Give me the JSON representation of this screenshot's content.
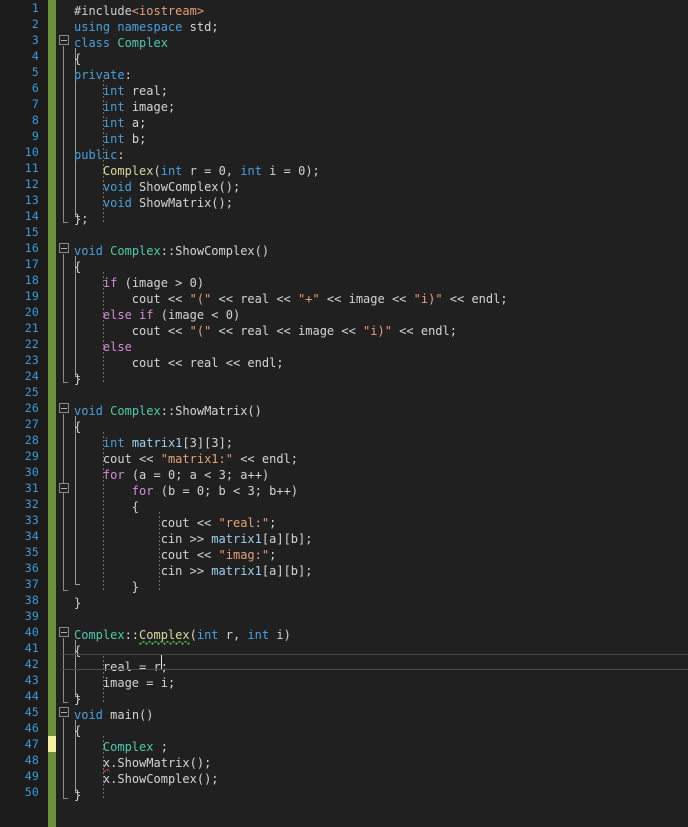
{
  "editor": {
    "language": "C++",
    "theme": "dark",
    "colors": {
      "background": "#202020",
      "gutter_background": "#1b1b1b",
      "line_number": "#3f9ad6",
      "keyword": "#4a9fdc",
      "control_keyword": "#d38fd3",
      "class_type": "#4ec9a6",
      "function_decl": "#d8d8a0",
      "string": "#e5a07a",
      "identifier": "#d4d4d4",
      "variable": "#9fd0ee",
      "change_bar_saved": "#6a8f3d",
      "change_bar_unsaved": "#f0f0a0",
      "error_squiggle": "#d64b3c",
      "warning_squiggle": "#4fbf4f",
      "current_line_border": "#4a4a4a",
      "caret": "#e8e8e8"
    },
    "first_line": 1,
    "last_line": 50,
    "current_line": 42,
    "caret_column": 14,
    "line_numbers": [
      1,
      2,
      3,
      4,
      5,
      6,
      7,
      8,
      9,
      10,
      11,
      12,
      13,
      14,
      15,
      16,
      17,
      18,
      19,
      20,
      21,
      22,
      23,
      24,
      25,
      26,
      27,
      28,
      29,
      30,
      31,
      32,
      33,
      34,
      35,
      36,
      37,
      38,
      39,
      40,
      41,
      42,
      43,
      44,
      45,
      46,
      47,
      48,
      49,
      50
    ],
    "fold_markers": [
      3,
      16,
      26,
      31,
      40,
      45
    ],
    "unsaved_change_lines": [
      47
    ],
    "lines": [
      {
        "n": 1,
        "text": "#include<iostream>"
      },
      {
        "n": 2,
        "text": "using namespace std;"
      },
      {
        "n": 3,
        "text": "class Complex"
      },
      {
        "n": 4,
        "text": "{"
      },
      {
        "n": 5,
        "text": "private:"
      },
      {
        "n": 6,
        "text": "    int real;"
      },
      {
        "n": 7,
        "text": "    int image;"
      },
      {
        "n": 8,
        "text": "    int a;"
      },
      {
        "n": 9,
        "text": "    int b;"
      },
      {
        "n": 10,
        "text": "public:"
      },
      {
        "n": 11,
        "text": "    Complex(int r = 0, int i = 0);"
      },
      {
        "n": 12,
        "text": "    void ShowComplex();"
      },
      {
        "n": 13,
        "text": "    void ShowMatrix();"
      },
      {
        "n": 14,
        "text": "};"
      },
      {
        "n": 15,
        "text": ""
      },
      {
        "n": 16,
        "text": "void Complex::ShowComplex()"
      },
      {
        "n": 17,
        "text": "{"
      },
      {
        "n": 18,
        "text": "    if (image > 0)"
      },
      {
        "n": 19,
        "text": "        cout << \"(\" << real << \"+\" << image << \"i)\" << endl;"
      },
      {
        "n": 20,
        "text": "    else if (image < 0)"
      },
      {
        "n": 21,
        "text": "        cout << \"(\" << real << image << \"i)\" << endl;"
      },
      {
        "n": 22,
        "text": "    else"
      },
      {
        "n": 23,
        "text": "        cout << real << endl;"
      },
      {
        "n": 24,
        "text": "}"
      },
      {
        "n": 25,
        "text": ""
      },
      {
        "n": 26,
        "text": "void Complex::ShowMatrix()"
      },
      {
        "n": 27,
        "text": "{"
      },
      {
        "n": 28,
        "text": "    int matrix1[3][3];"
      },
      {
        "n": 29,
        "text": "    cout << \"matrix1:\" << endl;"
      },
      {
        "n": 30,
        "text": "    for (a = 0; a < 3; a++)"
      },
      {
        "n": 31,
        "text": "        for (b = 0; b < 3; b++)"
      },
      {
        "n": 32,
        "text": "        {"
      },
      {
        "n": 33,
        "text": "            cout << \"real:\";"
      },
      {
        "n": 34,
        "text": "            cin >> matrix1[a][b];"
      },
      {
        "n": 35,
        "text": "            cout << \"imag:\";"
      },
      {
        "n": 36,
        "text": "            cin >> matrix1[a][b];"
      },
      {
        "n": 37,
        "text": "        }"
      },
      {
        "n": 38,
        "text": "}"
      },
      {
        "n": 39,
        "text": ""
      },
      {
        "n": 40,
        "text": "Complex::Complex(int r, int i)"
      },
      {
        "n": 41,
        "text": "{"
      },
      {
        "n": 42,
        "text": "    real = r;"
      },
      {
        "n": 43,
        "text": "    image = i;"
      },
      {
        "n": 44,
        "text": "}"
      },
      {
        "n": 45,
        "text": "void main()"
      },
      {
        "n": 46,
        "text": "{"
      },
      {
        "n": 47,
        "text": "    Complex ;"
      },
      {
        "n": 48,
        "text": "    x.ShowMatrix();"
      },
      {
        "n": 49,
        "text": "    x.ShowComplex();"
      },
      {
        "n": 50,
        "text": "}"
      }
    ],
    "diagnostics": [
      {
        "line": 40,
        "token": "Complex",
        "severity": "warning",
        "squiggle_color": "#4fbf4f"
      },
      {
        "line": 48,
        "token": "x",
        "severity": "error",
        "squiggle_color": "#d64b3c"
      }
    ]
  }
}
